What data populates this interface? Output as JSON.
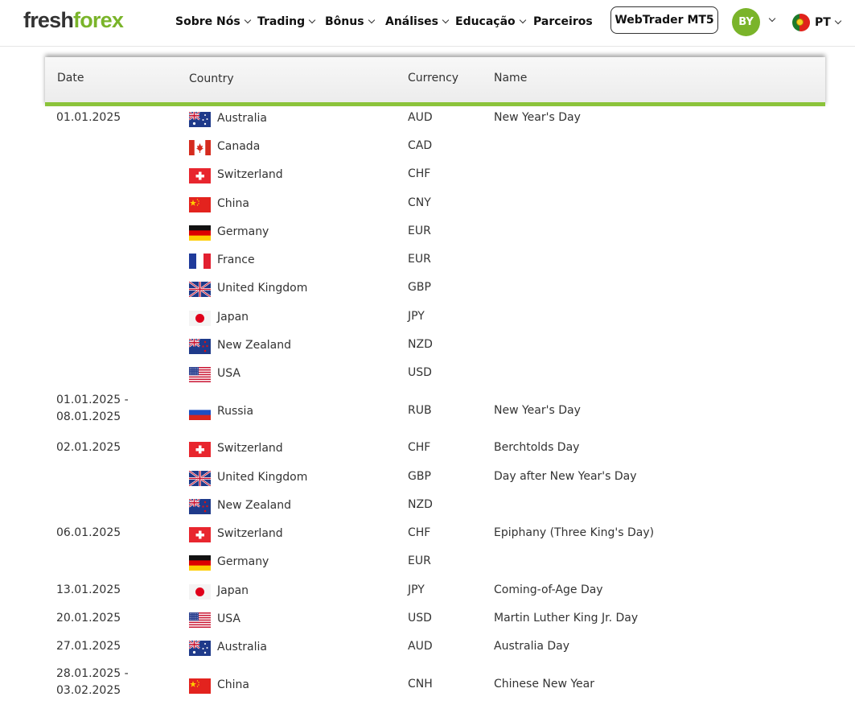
{
  "header": {
    "logo_part1": "fresh",
    "logo_part2": "forex",
    "nav": [
      {
        "label": "Sobre Nós",
        "dropdown": true
      },
      {
        "label": "Trading",
        "dropdown": true
      },
      {
        "label": "Bônus",
        "dropdown": true
      },
      {
        "label": "Análises",
        "dropdown": true
      },
      {
        "label": "Educação",
        "dropdown": true
      },
      {
        "label": "Parceiros",
        "dropdown": false
      }
    ],
    "webtrader_label": "WebTrader MT5",
    "avatar_initials": "BY",
    "language": "PT"
  },
  "table": {
    "headers": {
      "date": "Date",
      "country": "Country",
      "currency": "Currency",
      "name": "Name"
    },
    "rows": [
      {
        "date": "01.01.2025",
        "country": "Australia",
        "flag": "au",
        "currency": "AUD",
        "name": "New Year's Day"
      },
      {
        "date": "",
        "country": "Canada",
        "flag": "ca",
        "currency": "CAD",
        "name": ""
      },
      {
        "date": "",
        "country": "Switzerland",
        "flag": "ch",
        "currency": "CHF",
        "name": ""
      },
      {
        "date": "",
        "country": "China",
        "flag": "cn",
        "currency": "CNY",
        "name": ""
      },
      {
        "date": "",
        "country": "Germany",
        "flag": "de",
        "currency": "EUR",
        "name": ""
      },
      {
        "date": "",
        "country": "France",
        "flag": "fr",
        "currency": "EUR",
        "name": ""
      },
      {
        "date": "",
        "country": "United Kingdom",
        "flag": "gb",
        "currency": "GBP",
        "name": ""
      },
      {
        "date": "",
        "country": "Japan",
        "flag": "jp",
        "currency": "JPY",
        "name": ""
      },
      {
        "date": "",
        "country": "New Zealand",
        "flag": "nz",
        "currency": "NZD",
        "name": ""
      },
      {
        "date": "",
        "country": "USA",
        "flag": "us",
        "currency": "USD",
        "name": ""
      },
      {
        "date": "01.01.2025 -",
        "date2": "08.01.2025",
        "country": "Russia",
        "flag": "ru",
        "currency": "RUB",
        "name": "New Year's Day"
      },
      {
        "date": "02.01.2025",
        "country": "Switzerland",
        "flag": "ch",
        "currency": "CHF",
        "name": "Berchtolds Day"
      },
      {
        "date": "",
        "country": "United Kingdom",
        "flag": "gb",
        "currency": "GBP",
        "name": "Day after New Year's Day"
      },
      {
        "date": "",
        "country": "New Zealand",
        "flag": "nz",
        "currency": "NZD",
        "name": ""
      },
      {
        "date": "06.01.2025",
        "country": "Switzerland",
        "flag": "ch",
        "currency": "CHF",
        "name": "Epiphany (Three King's Day)"
      },
      {
        "date": "",
        "country": "Germany",
        "flag": "de",
        "currency": "EUR",
        "name": ""
      },
      {
        "date": "13.01.2025",
        "country": "Japan",
        "flag": "jp",
        "currency": "JPY",
        "name": "Coming-of-Age Day"
      },
      {
        "date": "20.01.2025",
        "country": "USA",
        "flag": "us",
        "currency": "USD",
        "name": "Martin Luther King Jr. Day"
      },
      {
        "date": "27.01.2025",
        "country": "Australia",
        "flag": "au",
        "currency": "AUD",
        "name": "Australia Day"
      },
      {
        "date": "28.01.2025 -",
        "date2": "03.02.2025",
        "country": "China",
        "flag": "cn",
        "currency": "CNH",
        "name": "Chinese New Year"
      }
    ]
  }
}
